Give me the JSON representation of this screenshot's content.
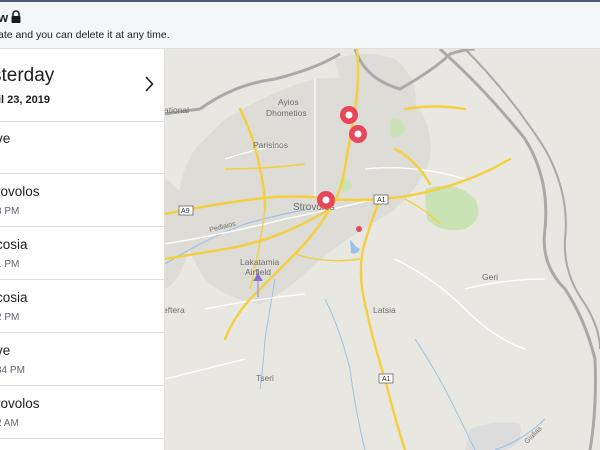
{
  "header": {
    "title": "w",
    "subtitle": "ate and you can delete it at any time."
  },
  "timeline": {
    "day": "sterday",
    "date": "il 23, 2019",
    "entries": [
      {
        "place": "ve",
        "time": ""
      },
      {
        "place": "rovolos",
        "time": "3 PM"
      },
      {
        "place": "cosia",
        "time": "1 PM"
      },
      {
        "place": "cosia",
        "time": "2 PM"
      },
      {
        "place": "ve",
        "time": "34 PM"
      },
      {
        "place": "rovolos",
        "time": "2 AM"
      }
    ]
  },
  "map": {
    "labels": {
      "ayios": "Ayios",
      "dhometios": "Dhometios",
      "ational": "ational",
      "parisinos": "Parisinos",
      "strovolos": "Strovolos",
      "pediaios": "Pediaios",
      "lakatamia": "Lakatamia",
      "airfield": "Airfield",
      "geri": "Geri",
      "latsia": "Latsia",
      "eftera": "eftera",
      "tseri": "Tseri",
      "gialias": "Gialias"
    },
    "road_shields": {
      "a9": "A9",
      "a1_north": "A1",
      "a1_south": "A1"
    },
    "colors": {
      "pin": "#e8465b",
      "highway": "#f4cf3e",
      "border": "#a9a9a9",
      "park": "#c9e3b4",
      "water": "#9bc3e6"
    }
  }
}
